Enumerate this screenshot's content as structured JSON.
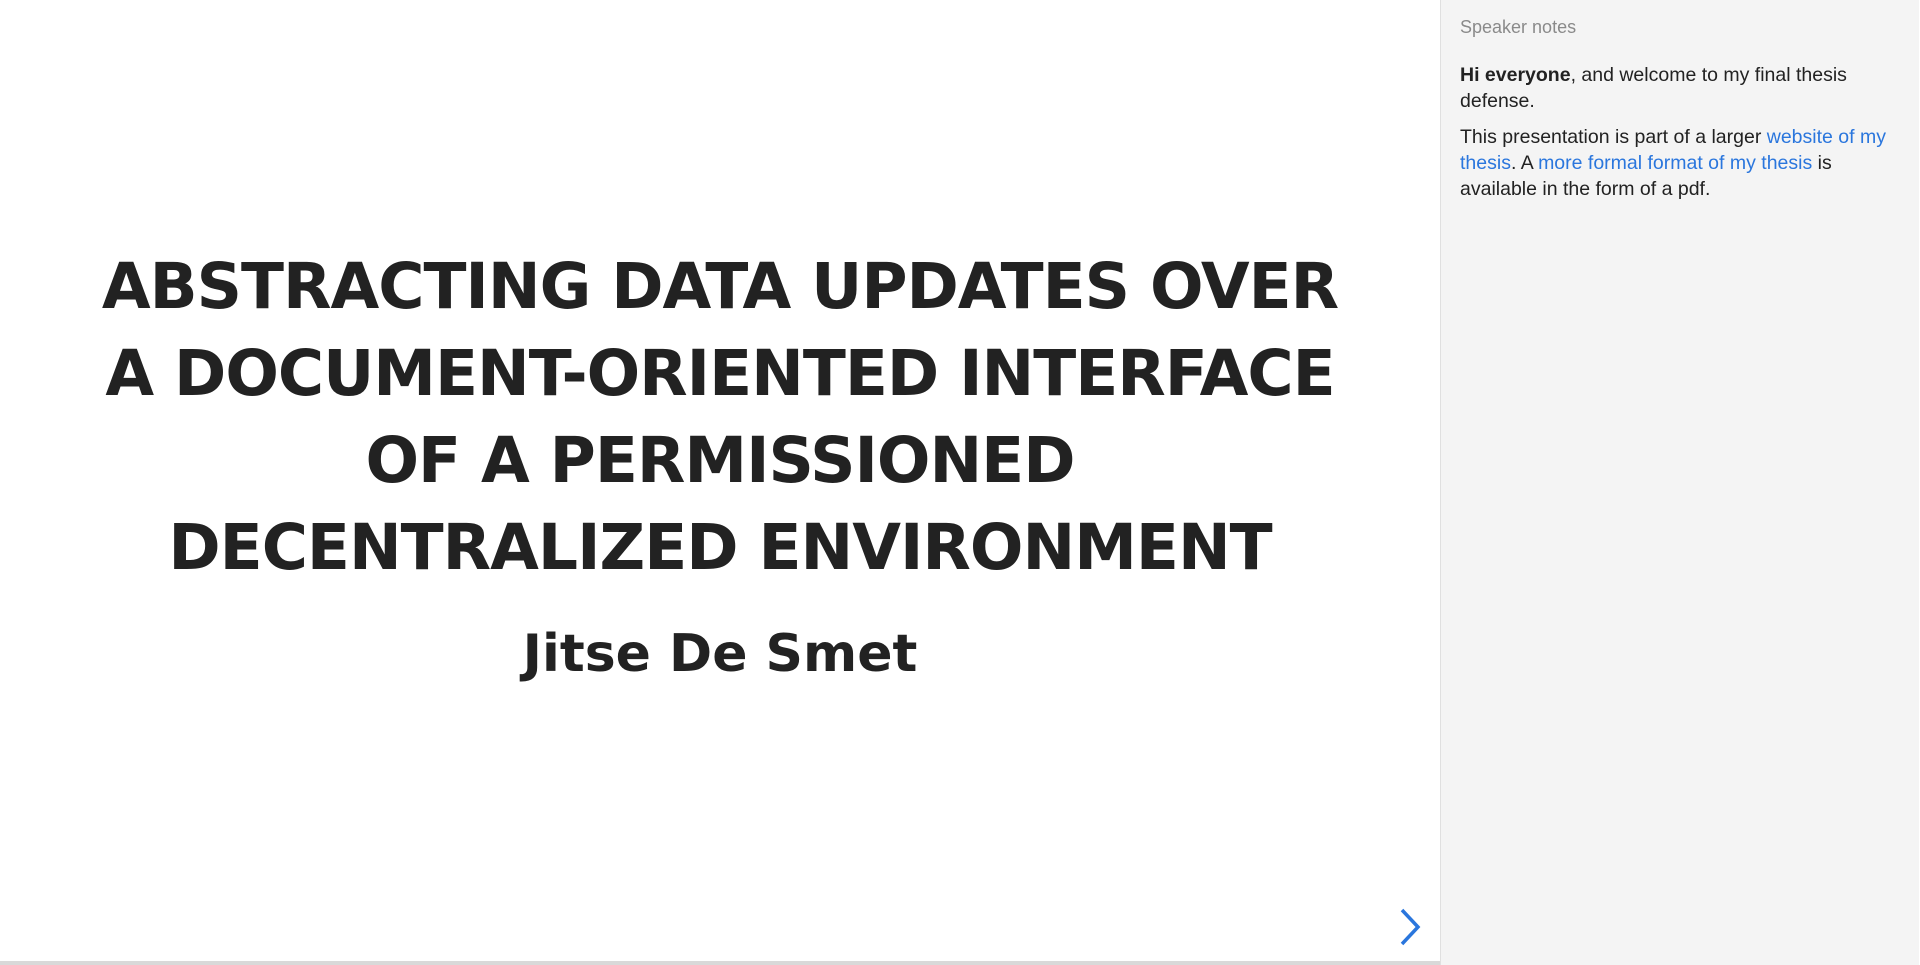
{
  "slide": {
    "title": "ABSTRACTING DATA UPDATES OVER A DOCUMENT-ORIENTED INTERFACE OF A PERMISSIONED DECENTRALIZED ENVIRONMENT",
    "author": "Jitse De Smet",
    "progress_fraction": 0
  },
  "navigation": {
    "next_icon": "chevron-right-icon",
    "accent_color": "#2a76dd"
  },
  "notes": {
    "heading": "Speaker notes",
    "p1": {
      "bold": "Hi everyone",
      "rest": ", and welcome to my final thesis defense."
    },
    "p2": {
      "t1": "This presentation is part of a larger ",
      "link1": "website of my thesis",
      "t2": ". A ",
      "link2": "more formal format of my thesis",
      "t3": " is available in the form of a pdf."
    }
  },
  "colors": {
    "text": "#222222",
    "notes_background": "#f4f4f4",
    "notes_heading": "#8a8a8a",
    "link": "#2a76dd"
  }
}
